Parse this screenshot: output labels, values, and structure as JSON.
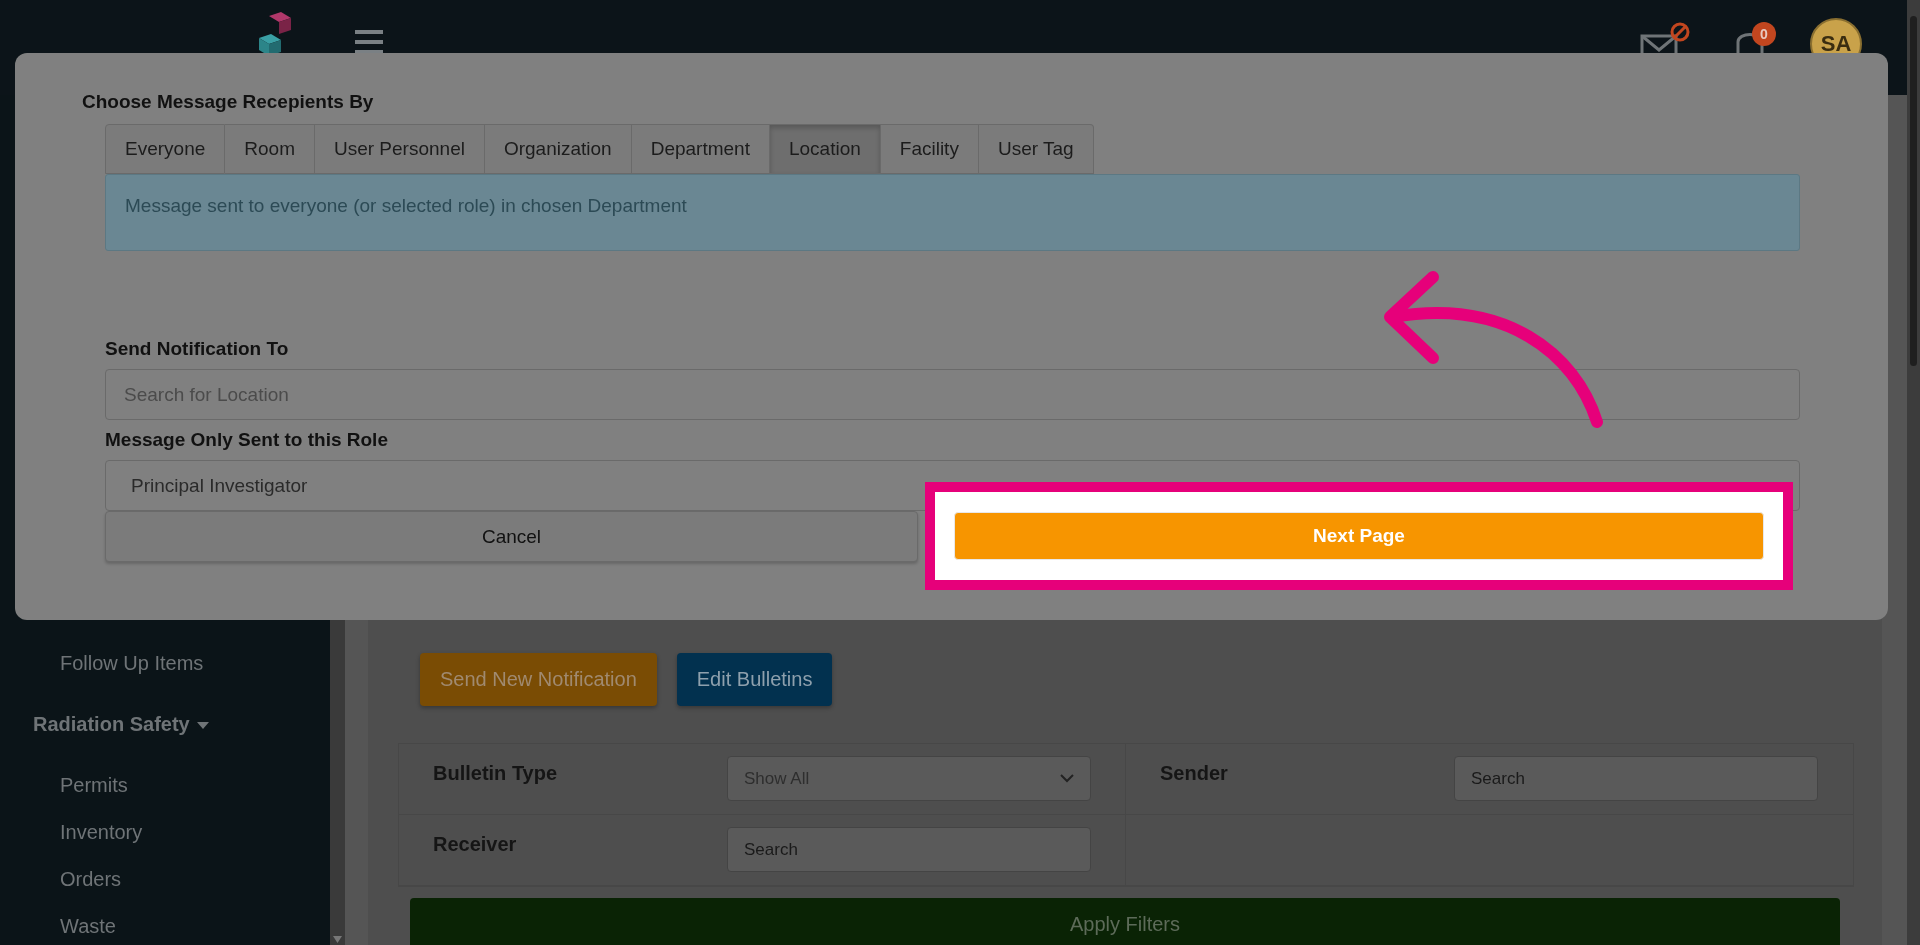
{
  "header": {
    "notification_count": "0",
    "avatar_initials": "SA"
  },
  "sidebar": {
    "items": [
      {
        "label": "Follow Up Items",
        "kind": "link"
      },
      {
        "label": "Radiation Safety",
        "kind": "section",
        "expanded": true
      },
      {
        "label": "Permits",
        "kind": "link"
      },
      {
        "label": "Inventory",
        "kind": "link"
      },
      {
        "label": "Orders",
        "kind": "link"
      },
      {
        "label": "Waste",
        "kind": "link"
      }
    ]
  },
  "main": {
    "buttons": [
      {
        "label": "Send New Notification",
        "kind": "primary"
      },
      {
        "label": "Edit Bulletins",
        "kind": "secondary"
      }
    ],
    "filters": [
      {
        "label": "Bulletin Type",
        "kind": "select",
        "value": "Show All"
      },
      {
        "label": "Sender",
        "kind": "search",
        "placeholder": "Search"
      },
      {
        "label": "Receiver",
        "kind": "search",
        "placeholder": "Search"
      }
    ],
    "apply_button": "Apply Filters"
  },
  "modal": {
    "heading": "Choose Message Recepients By",
    "tabs": [
      {
        "label": "Everyone",
        "selected": false
      },
      {
        "label": "Room",
        "selected": false
      },
      {
        "label": "User Personnel",
        "selected": false
      },
      {
        "label": "Organization",
        "selected": false
      },
      {
        "label": "Department",
        "selected": false
      },
      {
        "label": "Location",
        "selected": true
      },
      {
        "label": "Facility",
        "selected": false
      },
      {
        "label": "User Tag",
        "selected": false
      }
    ],
    "info": "Message sent to everyone (or selected role) in chosen Department",
    "notify_label": "Send Notification To",
    "notify_field": {
      "placeholder": "Search for Location"
    },
    "role_label": "Message Only Sent to this Role",
    "role_select": {
      "value": "Principal Investigator"
    },
    "cancel_button": "Cancel",
    "next_button": "Next Page"
  },
  "annotations": {
    "highlight_frame": true,
    "pointer_arrow": true
  }
}
